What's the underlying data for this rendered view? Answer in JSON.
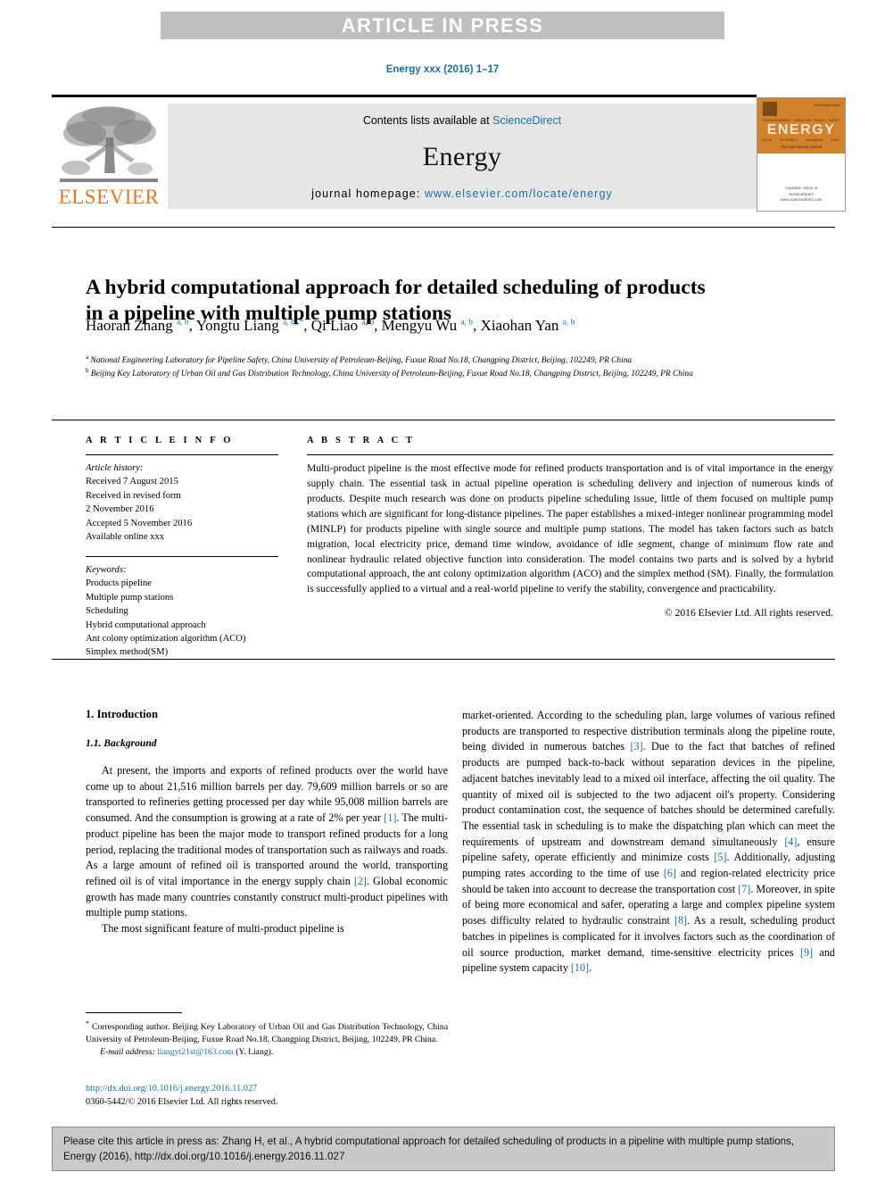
{
  "banner": {
    "label": "ARTICLE IN PRESS"
  },
  "running_head": {
    "text": "Energy xxx (2016) 1–17"
  },
  "masthead": {
    "contents_prefix": "Contents lists available at ",
    "contents_link": "ScienceDirect",
    "journal_name": "Energy",
    "homepage_prefix": "journal homepage: ",
    "homepage_link": "www.elsevier.com/locate/energy",
    "publisher_name": "ELSEVIER",
    "cover": {
      "title": "ENERGY",
      "top_right": "ISSN 0360-5442",
      "keywords_row1": [
        "THERMODYNAMICS",
        "MODELLING",
        "POLICY",
        "SUPPLY"
      ],
      "keywords_row2": [
        "SOLAR",
        "eFFICIENCY",
        "renewABLES",
        "FUELS"
      ],
      "subtitle": "The International Journal",
      "bottom_line1": "Available online at",
      "bottom_line2": "ScienceDirect",
      "bottom_line3": "www.sciencedirect.com"
    }
  },
  "article": {
    "title_line1": "A hybrid computational approach for detailed scheduling of products",
    "title_line2": "in a pipeline with multiple pump stations",
    "authors": [
      {
        "name": "Haoran Zhang",
        "sup": "a, b",
        "sep": ", "
      },
      {
        "name": "Yongtu Liang",
        "sup": "a, b, *",
        "sep": ", "
      },
      {
        "name": "Qi Liao",
        "sup": "a, b",
        "sep": ", "
      },
      {
        "name": "Mengyu Wu",
        "sup": "a, b",
        "sep": ", "
      },
      {
        "name": "Xiaohan Yan",
        "sup": "a, b",
        "sep": ""
      }
    ],
    "affiliations": [
      {
        "marker": "a",
        "text": "National Engineering Laboratory for Pipeline Safety, China University of Petroleum-Beijing, Fuxue Road No.18, Changping District, Beijing, 102249, PR China"
      },
      {
        "marker": "b",
        "text": "Beijing Key Laboratory of Urban Oil and Gas Distribution Technology, China University of Petroleum-Beijing, Fuxue Road No.18, Changping District, Beijing, 102249, PR China"
      }
    ]
  },
  "article_info": {
    "heading": "A R T I C L E  I N F O",
    "history_label": "Article history:",
    "history": [
      "Received 7 August 2015",
      "Received in revised form",
      "2 November 2016",
      "Accepted 5 November 2016",
      "Available online xxx"
    ],
    "keywords_label": "Keywords:",
    "keywords": [
      "Products pipeline",
      "Multiple pump stations",
      "Scheduling",
      "Hybrid computational approach",
      "Ant colony optimization algorithm (ACO)",
      "Simplex method(SM)"
    ]
  },
  "abstract": {
    "heading": "A B S T R A C T",
    "text": "Multi-product pipeline is the most effective mode for refined products transportation and is of vital importance in the energy supply chain. The essential task in actual pipeline operation is scheduling delivery and injection of numerous kinds of products. Despite much research was done on products pipeline scheduling issue, little of them focused on multiple pump stations which are significant for long-distance pipelines. The paper establishes a mixed-integer nonlinear programming model (MINLP) for products pipeline with single source and multiple pump stations. The model has taken factors such as batch migration, local electricity price, demand time window, avoidance of idle segment, change of minimum flow rate and nonlinear hydraulic related objective function into consideration. The model contains two parts and is solved by a hybrid computational approach, the ant colony optimization algorithm (ACO) and the simplex method (SM). Finally, the formulation is successfully applied to a virtual and a real-world pipeline to verify the stability, convergence and practicability.",
    "copyright": "© 2016 Elsevier Ltd. All rights reserved."
  },
  "body": {
    "section_number_title": "1.  Introduction",
    "subsection_number_title": "1.1.  Background",
    "left_para_1_a": "At present, the imports and exports of refined products over the world have come up to about 21,516 million barrels per day. 79,609 million barrels or so are transported to refineries getting processed per day while 95,008 million barrels are consumed. And the consumption is growing at a rate of 2% per year ",
    "left_para_1_ref": "[1]",
    "left_para_1_b": ". The multi-product pipeline has been the major mode to transport refined products for a long period, replacing the traditional modes of transportation such as railways and roads. As a large amount of refined oil is transported around the world, transporting refined oil is of vital importance in the energy supply chain ",
    "left_para_1_ref2": "[2]",
    "left_para_1_c": ". Global economic growth has made many countries constantly construct multi-product pipelines with multiple pump stations.",
    "left_para_2": "The most significant feature of multi-product pipeline is",
    "right_para_1_a": "market-oriented. According to the scheduling plan, large volumes of various refined products are transported to respective distribution terminals along the pipeline route, being divided in numerous batches ",
    "right_para_1_ref": "[3]",
    "right_para_1_b": ". Due to the fact that batches of refined products are pumped back-to-back without separation devices in the pipeline, adjacent batches inevitably lead to a mixed oil interface, affecting the oil quality. The quantity of mixed oil is subjected to the two adjacent oil's property. Considering product contamination cost, the sequence of batches should be determined carefully. The essential task in scheduling is to make the dispatching plan which can meet the requirements of upstream and downstream demand simultaneously ",
    "right_para_1_ref2": "[4]",
    "right_para_1_c": ", ensure pipeline safety, operate efficiently and minimize costs ",
    "right_para_1_ref3": "[5]",
    "right_para_1_d": ". Additionally, adjusting pumping rates according to the time of use ",
    "right_para_1_ref4": "[6]",
    "right_para_1_e": " and region-related electricity price should be taken into account to decrease the transportation cost ",
    "right_para_1_ref5": "[7]",
    "right_para_1_f": ". Moreover, in spite of being more economical and safer, operating a large and complex pipeline system poses difficulty related to hydraulic constraint ",
    "right_para_1_ref6": "[8]",
    "right_para_1_g": ". As a result, scheduling product batches in pipelines is complicated for it involves factors such as the coordination of oil source production, market demand, time-sensitive electricity prices ",
    "right_para_1_ref7": "[9]",
    "right_para_1_h": " and pipeline system capacity ",
    "right_para_1_ref8": "[10]",
    "right_para_1_i": "."
  },
  "footnote": {
    "star": "*",
    "text": " Corresponding author. Beijing Key Laboratory of Urban Oil and Gas Distribution Technology, China University of Petroleum-Beijing, Fuxue Road No.18, Changping District, Beijing, 102249, PR China.",
    "email_label": "E-mail address:",
    "email": "liangyt21st@163.com",
    "email_suffix": " (Y. Liang)."
  },
  "doi": {
    "link": "http://dx.doi.org/10.1016/j.energy.2016.11.027",
    "issn_line": "0360-5442/© 2016 Elsevier Ltd. All rights reserved."
  },
  "cite_box": {
    "text": "Please cite this article in press as: Zhang H, et al., A hybrid computational approach for detailed scheduling of products in a pipeline with multiple pump stations, Energy (2016), http://dx.doi.org/10.1016/j.energy.2016.11.027"
  },
  "colors": {
    "link": "#1b6ea5",
    "banner_bg": "#bfbfbf",
    "elsevier_orange": "#e87722",
    "masthead_bg": "#e6e6e6",
    "cite_bg": "#c9c9c9"
  }
}
